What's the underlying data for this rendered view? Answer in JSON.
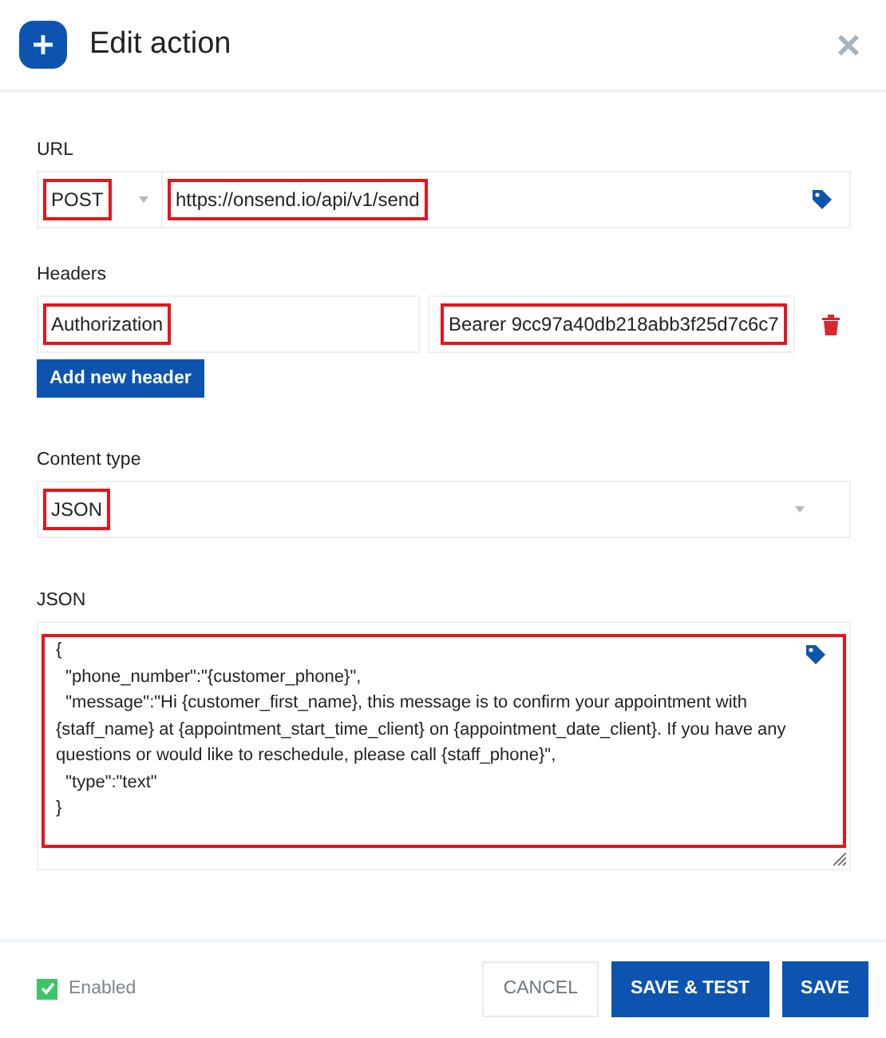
{
  "dialog": {
    "title": "Edit action",
    "close": "×"
  },
  "url": {
    "label": "URL",
    "method": {
      "value": "POST",
      "highlighted": true
    },
    "address": {
      "value": "https://onsend.io/api/v1/send",
      "highlighted": true
    }
  },
  "headers": {
    "label": "Headers",
    "rows": [
      {
        "name": {
          "value": "Authorization",
          "highlighted": true
        },
        "value": {
          "value": "Bearer 9cc97a40db218abb3f25d7c6c7",
          "highlighted": true
        }
      }
    ],
    "add_button": "Add new header"
  },
  "content_type": {
    "label": "Content type",
    "value": "JSON",
    "highlighted": true
  },
  "body": {
    "label": "JSON",
    "value": "{\n  \"phone_number\":\"{customer_phone}\",\n  \"message\":\"Hi {customer_first_name}, this message is to confirm your appointment with {staff_name} at {appointment_start_time_client} on {appointment_date_client}. If you have any questions or would like to reschedule, please call {staff_phone}\",\n  \"type\":\"text\"\n}",
    "highlighted": true
  },
  "footer": {
    "enabled": {
      "label": "Enabled",
      "checked": true
    },
    "buttons": [
      {
        "label": "CANCEL",
        "kind": "secondary"
      },
      {
        "label": "SAVE & TEST",
        "kind": "primary"
      },
      {
        "label": "SAVE",
        "kind": "primary"
      }
    ]
  }
}
